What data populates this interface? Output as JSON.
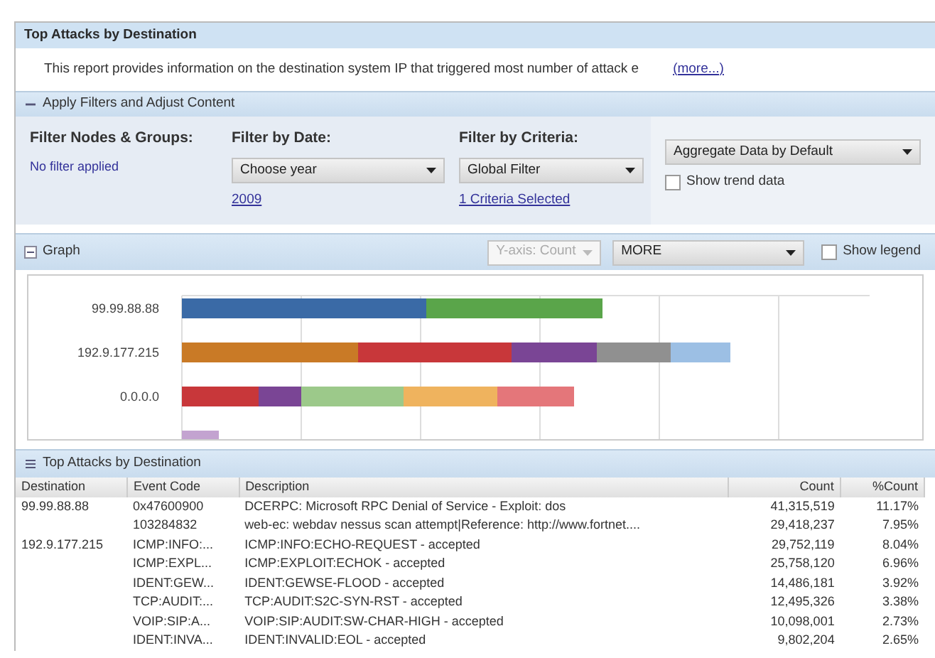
{
  "report": {
    "title": "Top Attacks by Destination",
    "description": "This report provides information on the destination system IP that triggered most number of attack e",
    "more_link": "(more...)"
  },
  "filters": {
    "title": "Apply Filters and Adjust Content",
    "expanded": true,
    "nodes": {
      "label": "Filter Nodes & Groups:",
      "value": "No filter applied"
    },
    "date": {
      "label": "Filter by Date:",
      "select": "Choose year",
      "note": "2009"
    },
    "criteria": {
      "label": "Filter by Criteria:",
      "select": "Global Filter",
      "note": "1 Criteria Selected"
    },
    "aggregate": {
      "select": "Aggregate Data by Default"
    },
    "trend": {
      "label": "Show trend data",
      "checked": false
    }
  },
  "graph": {
    "title": "Graph",
    "yaxis": {
      "select": "Y-axis: Count",
      "disabled": true
    },
    "more": {
      "select": "MORE"
    },
    "legend": {
      "label": "Show legend",
      "checked": false
    },
    "bar_labels": [
      "99.99.88.88",
      "192.9.177.215",
      "0.0.0.0"
    ]
  },
  "table": {
    "title": "Top Attacks by Destination",
    "columns": [
      "Destination",
      "Event Code",
      "Description",
      "Count",
      "%Count"
    ],
    "rows": [
      [
        "99.99.88.88",
        "0x47600900",
        "DCERPC: Microsoft RPC Denial of Service - Exploit: dos",
        "41,315,519",
        "11.17%"
      ],
      [
        "",
        "103284832",
        "web-ec: webdav nessus scan attempt|Reference: http://www.fortnet....",
        "29,418,237",
        "7.95%"
      ],
      [
        "192.9.177.215",
        "ICMP:INFO:...",
        "ICMP:INFO:ECHO-REQUEST - accepted",
        "29,752,119",
        "8.04%"
      ],
      [
        "",
        "ICMP:EXPL...",
        "ICMP:EXPLOIT:ECHOK - accepted",
        "25,758,120",
        "6.96%"
      ],
      [
        "",
        "IDENT:GEW...",
        "IDENT:GEWSE-FLOOD - accepted",
        "14,486,181",
        "3.92%"
      ],
      [
        "",
        "TCP:AUDIT:...",
        "TCP:AUDIT:S2C-SYN-RST - accepted",
        "12,495,326",
        "3.38%"
      ],
      [
        "",
        "VOIP:SIP:A...",
        "VOIP:SIP:AUDIT:SW-CHAR-HIGH - accepted",
        "10,098,001",
        "2.73%"
      ],
      [
        "",
        "IDENT:INVA...",
        "IDENT:INVALID:EOL - accepted",
        "9,802,204",
        "2.65%"
      ]
    ]
  }
}
